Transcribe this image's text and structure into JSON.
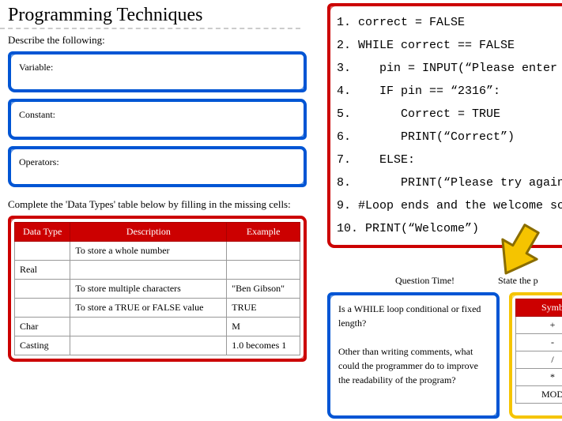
{
  "title": "Programming Techniques",
  "describe_heading": "Describe the following:",
  "boxes": {
    "variable": "Variable:",
    "constant": "Constant:",
    "operators": "Operators:"
  },
  "table_heading": "Complete the 'Data Types' table below by filling in the missing cells:",
  "table": {
    "headers": [
      "Data Type",
      "Description",
      "Example"
    ],
    "rows": [
      [
        "",
        "To store a whole number",
        ""
      ],
      [
        "Real",
        "",
        ""
      ],
      [
        "",
        "To store multiple characters",
        "\"Ben Gibson\""
      ],
      [
        "",
        "To store a TRUE or FALSE value",
        "TRUE"
      ],
      [
        "Char",
        "",
        "M"
      ],
      [
        "Casting",
        "",
        "1.0 becomes 1"
      ]
    ]
  },
  "code": [
    "1. correct = FALSE",
    "2. WHILE correct == FALSE",
    "3.    pin = INPUT(“Please enter ",
    "4.    IF pin == “2316”:",
    "5.       Correct = TRUE",
    "6.       PRINT(“Correct”)",
    "7.    ELSE:",
    "8.       PRINT(“Please try again",
    "9. #Loop ends and the welcome sc",
    "10. PRINT(“Welcome”)"
  ],
  "question_time": "Question Time!",
  "state_p": "State the p",
  "questions": {
    "q1": "Is a WHILE loop conditional or fixed length?",
    "q2": "Other than writing comments, what could the programmer do to improve the readability of the program?"
  },
  "sym_header": "Symb",
  "sym_rows": [
    "+",
    "-",
    "/",
    "*",
    "MOD"
  ]
}
